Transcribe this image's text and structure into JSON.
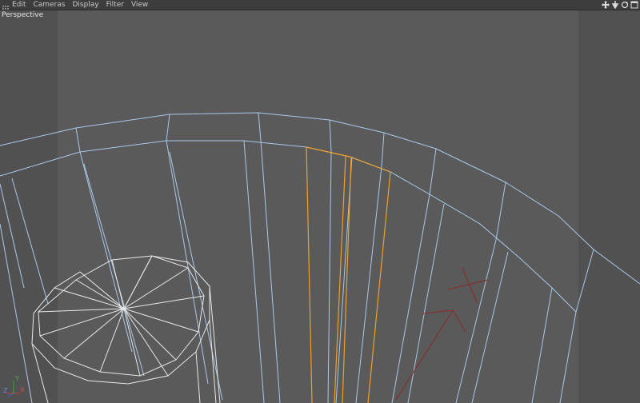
{
  "menu": {
    "items": [
      "Edit",
      "Cameras",
      "Display",
      "Filter",
      "View"
    ]
  },
  "viewport": {
    "label": "Perspective"
  },
  "nav_icons": [
    "move-icon",
    "zoom-icon",
    "rotate-icon",
    "maximize-icon"
  ],
  "axes": {
    "x": "X",
    "y": "Y",
    "z": "Z"
  },
  "colors": {
    "background": "#5a5a5a",
    "wire_blue": "#a9c8e8",
    "wire_selected": "#f0a02a",
    "wire_white": "#e8e8e8",
    "wire_red": "#8a2a2a"
  }
}
